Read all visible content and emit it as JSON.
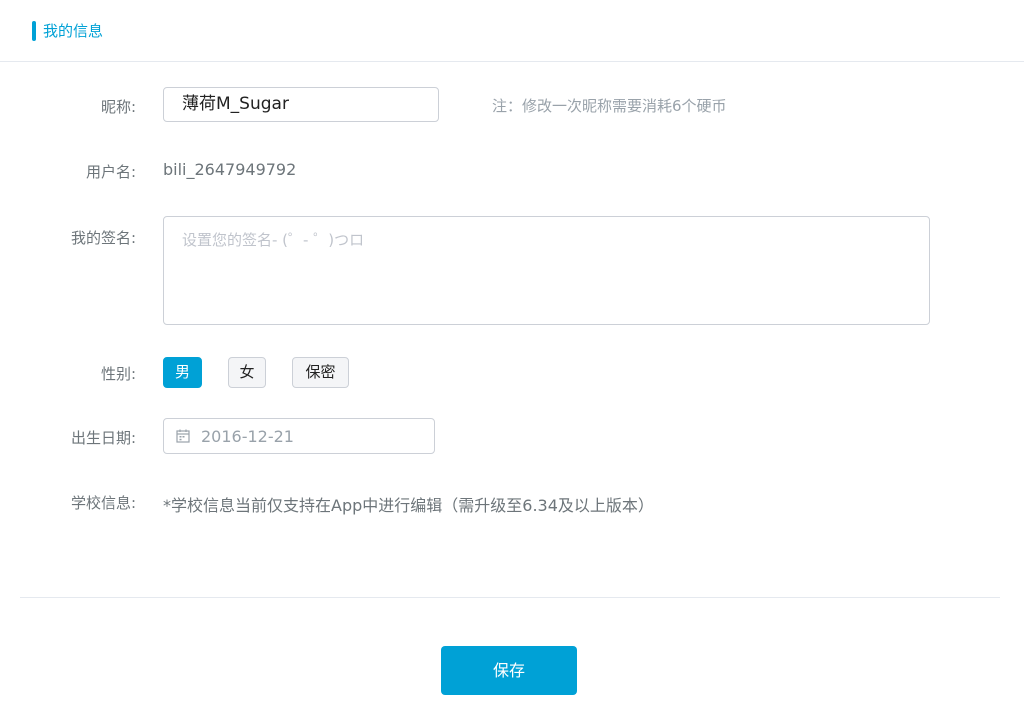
{
  "header": {
    "title": "我的信息"
  },
  "form": {
    "nickname": {
      "label": "昵称:",
      "value": "薄荷M_Sugar",
      "note": "注：修改一次昵称需要消耗6个硬币"
    },
    "username": {
      "label": "用户名:",
      "value": "bili_2647949792"
    },
    "signature": {
      "label": "我的签名:",
      "placeholder": "设置您的签名- (゜- ゜)つロ"
    },
    "gender": {
      "label": "性别:",
      "options": [
        "男",
        "女",
        "保密"
      ],
      "selected": "男"
    },
    "birthday": {
      "label": "出生日期:",
      "value": "2016-12-21",
      "icon": "calendar-icon"
    },
    "school": {
      "label": "学校信息:",
      "value": "*学校信息当前仅支持在App中进行编辑（需升级至6.34及以上版本）"
    }
  },
  "footer": {
    "save_label": "保存"
  },
  "colors": {
    "accent": "#00a1d6",
    "border": "#ccd0d7",
    "text": "#6d757a"
  }
}
